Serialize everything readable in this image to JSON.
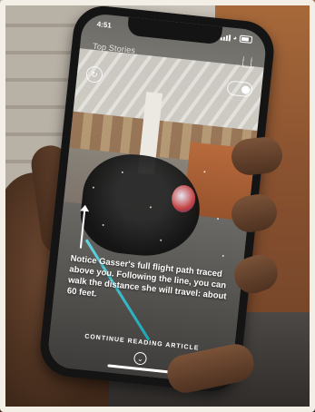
{
  "status_bar": {
    "time": "4:51"
  },
  "header": {
    "title": "Top Stories"
  },
  "caption": {
    "text": "Notice Gasser's full flight path traced above you. Following the line, you can walk the distance she will travel: about 60 feet."
  },
  "footer": {
    "continue_label": "CONTINUE READING ARTICLE"
  },
  "icons": {
    "reset": "reset-icon",
    "toggle": "toggle-icon",
    "share": "share-icon",
    "chevron": "chevron-down-icon"
  },
  "colors": {
    "flight_path": "#1aa7b8"
  }
}
